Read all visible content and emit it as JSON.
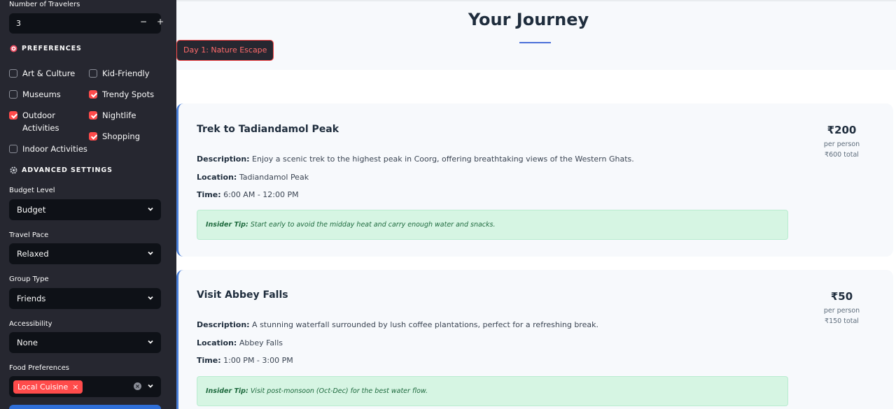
{
  "sidebar": {
    "travelers": {
      "label": "Number of Travelers",
      "value": "3",
      "minus": "−",
      "plus": "+"
    },
    "preferences": {
      "heading": "PREFERENCES",
      "options": [
        {
          "label": "Art & Culture",
          "checked": false
        },
        {
          "label": "Kid-Friendly",
          "checked": false
        },
        {
          "label": "Museums",
          "checked": false
        },
        {
          "label": "Trendy Spots",
          "checked": true
        },
        {
          "label": "Outdoor Activities",
          "checked": true
        },
        {
          "label": "Nightlife",
          "checked": true
        },
        {
          "label": "Shopping",
          "checked": true
        },
        {
          "label": "Indoor Activities",
          "checked": false
        }
      ]
    },
    "advanced": {
      "heading": "ADVANCED SETTINGS",
      "budget": {
        "label": "Budget Level",
        "value": "Budget"
      },
      "pace": {
        "label": "Travel Pace",
        "value": "Relaxed"
      },
      "group": {
        "label": "Group Type",
        "value": "Friends"
      },
      "accessibility": {
        "label": "Accessibility",
        "value": "None"
      },
      "food": {
        "label": "Food Preferences",
        "tag": "Local Cuisine",
        "tag_close": "×"
      }
    }
  },
  "main": {
    "title": "Your Journey",
    "day_label": "Day 1: Nature Escape",
    "activities": [
      {
        "title": "Trek to Tadiandamol Peak",
        "description_label": "Description:",
        "description": "Enjoy a scenic trek to the highest peak in Coorg, offering breathtaking views of the Western Ghats.",
        "location_label": "Location:",
        "location": "Tadiandamol Peak",
        "time_label": "Time:",
        "time": "6:00 AM - 12:00 PM",
        "tip_label": "Insider Tip:",
        "tip": "Start early to avoid the midday heat and carry enough water and snacks.",
        "price": "₹200",
        "per_person": "per person",
        "total": "₹600 total"
      },
      {
        "title": "Visit Abbey Falls",
        "description_label": "Description:",
        "description": "A stunning waterfall surrounded by lush coffee plantations, perfect for a refreshing break.",
        "location_label": "Location:",
        "location": "Abbey Falls",
        "time_label": "Time:",
        "time": "1:00 PM - 3:00 PM",
        "tip_label": "Insider Tip:",
        "tip": "Visit post-monsoon (Oct-Dec) for the best water flow.",
        "price": "₹50",
        "per_person": "per person",
        "total": "₹150 total"
      }
    ]
  },
  "colors": {
    "sidebar_bg": "#262730",
    "input_bg": "#0e1117",
    "accent_red": "#ff4b4b",
    "card_border": "#4a7fd8",
    "tip_bg": "#d6f5e3"
  }
}
